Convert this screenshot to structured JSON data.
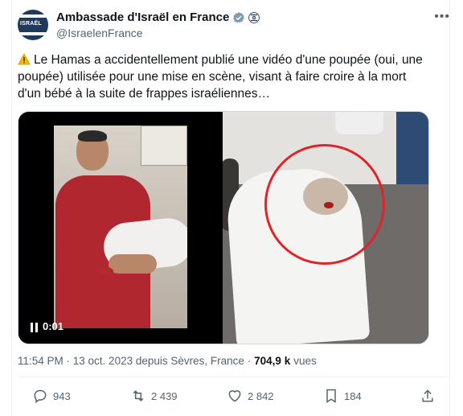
{
  "tweet": {
    "author_name": "Ambassade d'Israël en France",
    "handle": "@IsraelenFrance",
    "avatar_text": "ISRAËL",
    "text": "Le Hamas a accidentellement publié une vidéo d'une poupée (oui, une poupée) utilisée pour une mise en scène, visant à faire croire à la mort d'un bébé à la suite de frappes israéliennes…",
    "video_timecode": "0:01",
    "timestamp": "11:54 PM · 13 oct. 2023 depuis Sèvres, France ·",
    "views_count": "704,9 k",
    "views_label": "vues",
    "replies": "943",
    "reposts": "2 439",
    "likes": "2 842",
    "bookmarks": "184"
  },
  "icons": {
    "warning": "warning-icon",
    "verified": "verified-badge-icon",
    "affiliate": "affiliate-badge-icon",
    "more": "more-options-icon",
    "reply": "reply-icon",
    "repost": "repost-icon",
    "like": "like-icon",
    "bookmark": "bookmark-icon",
    "share": "share-icon",
    "pause": "pause-icon"
  },
  "colors": {
    "text": "#0f1419",
    "secondary": "#536471",
    "verified": "#829aab",
    "highlight_circle": "#e0242a"
  }
}
